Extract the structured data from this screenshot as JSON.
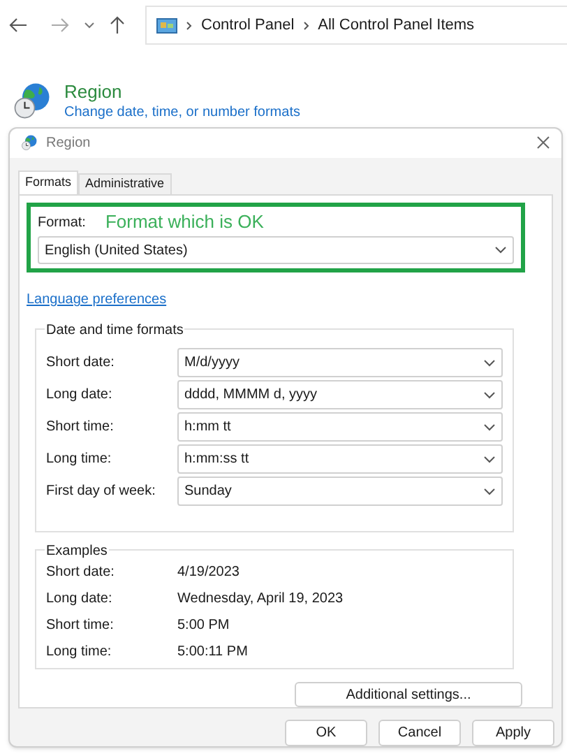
{
  "nav": {
    "breadcrumbs": [
      "Control Panel",
      "All Control Panel Items"
    ]
  },
  "header": {
    "title": "Region",
    "link": "Change date, time, or number formats"
  },
  "dialog": {
    "title": "Region",
    "tabs": [
      {
        "label": "Formats",
        "selected": true
      },
      {
        "label": "Administrative",
        "selected": false
      }
    ],
    "format": {
      "label": "Format:",
      "annotation": "Format which is OK",
      "value": "English (United States)"
    },
    "language_link": "Language preferences",
    "date_time_group": {
      "title": "Date and time formats",
      "rows": [
        {
          "label": "Short date:",
          "value": "M/d/yyyy"
        },
        {
          "label": "Long date:",
          "value": "dddd, MMMM d, yyyy"
        },
        {
          "label": "Short time:",
          "value": "h:mm tt"
        },
        {
          "label": "Long time:",
          "value": "h:mm:ss tt"
        },
        {
          "label": "First day of week:",
          "value": "Sunday"
        }
      ]
    },
    "examples_group": {
      "title": "Examples",
      "rows": [
        {
          "label": "Short date:",
          "value": "4/19/2023"
        },
        {
          "label": "Long date:",
          "value": "Wednesday, April 19, 2023"
        },
        {
          "label": "Short time:",
          "value": "5:00 PM"
        },
        {
          "label": "Long time:",
          "value": "5:00:11 PM"
        }
      ]
    },
    "additional_button": "Additional settings...",
    "buttons": [
      "OK",
      "Cancel",
      "Apply"
    ]
  }
}
